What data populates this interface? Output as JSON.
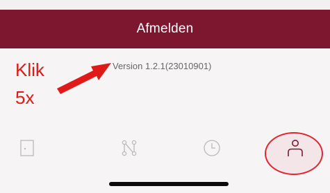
{
  "logout": {
    "label": "Afmelden"
  },
  "version": {
    "text": "Version 1.2.1(23010901)"
  },
  "annotation": {
    "line1": "Klik",
    "line2": "5x",
    "color": "#e01919"
  },
  "tabs": [
    {
      "icon": "door-icon",
      "active": false
    },
    {
      "icon": "route-icon",
      "active": false
    },
    {
      "icon": "clock-icon",
      "active": false
    },
    {
      "icon": "person-icon",
      "active": true
    }
  ],
  "colors": {
    "brand": "#7d1730",
    "active_tab": "#7d1730",
    "inactive_tab": "#b9b9b9",
    "annotation": "#e01919"
  }
}
